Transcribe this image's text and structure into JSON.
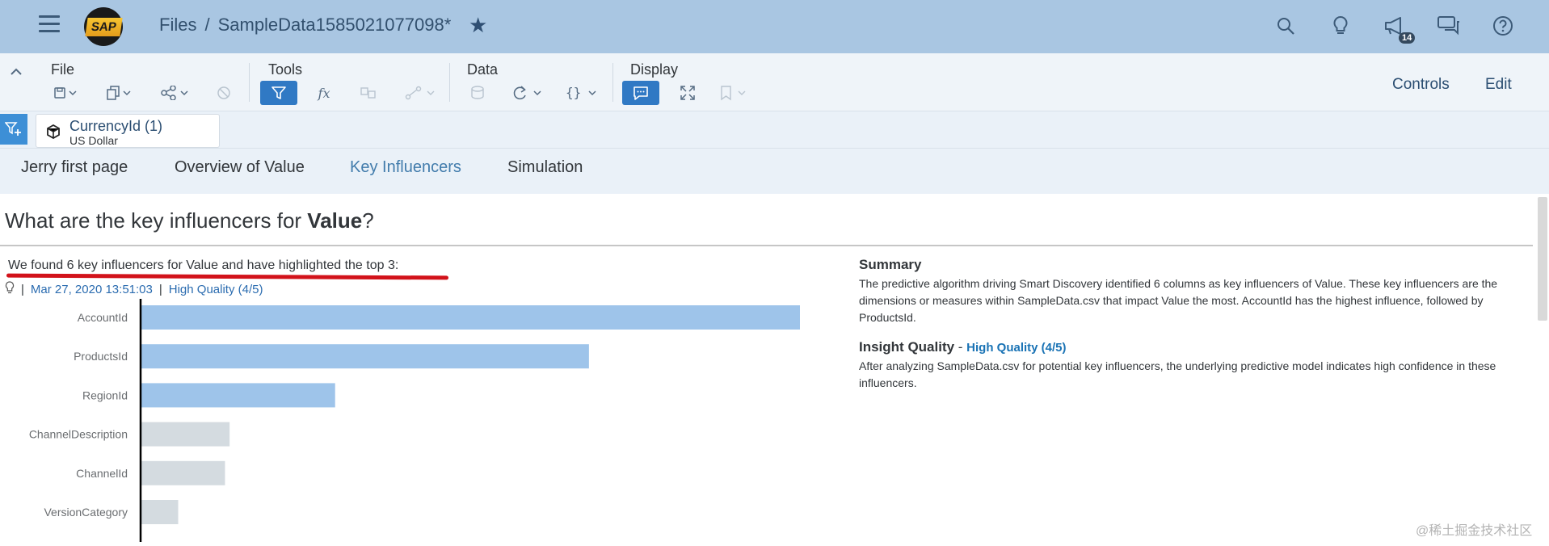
{
  "shell": {
    "breadcrumb_root": "Files",
    "breadcrumb_sep": "/",
    "document_title": "SampleData1585021077098*",
    "logo_text": "SAP",
    "notification_count": "14"
  },
  "toolbar": {
    "groups": {
      "file": "File",
      "tools": "Tools",
      "data": "Data",
      "display": "Display"
    },
    "controls_label": "Controls",
    "edit_label": "Edit"
  },
  "filter": {
    "token_title": "CurrencyId (1)",
    "token_value": "US Dollar"
  },
  "tabs": [
    {
      "label": "Jerry first page"
    },
    {
      "label": "Overview of Value"
    },
    {
      "label": "Key Influencers"
    },
    {
      "label": "Simulation"
    }
  ],
  "content": {
    "headline_prefix": "What are the key influencers for ",
    "headline_bold": "Value",
    "headline_suffix": "?",
    "found_text": "We found 6 key influencers for Value and have highlighted the top 3:",
    "timestamp": "Mar 27, 2020 13:51:03",
    "quality": "High Quality (4/5)"
  },
  "summary": {
    "title": "Summary",
    "text": "The predictive algorithm driving Smart Discovery identified 6 columns as key influencers of Value. These key influencers are the dimensions or measures within SampleData.csv that impact Value the most. AccountId has the highest influence, followed by ProductsId.",
    "insight_title": "Insight Quality",
    "insight_sep": " - ",
    "insight_quality": "High Quality (4/5)",
    "insight_text": "After analyzing SampleData.csv for potential key influencers, the underlying predictive model indicates high confidence in these influencers."
  },
  "chart_data": {
    "type": "bar",
    "orientation": "horizontal",
    "categories": [
      "AccountId",
      "ProductsId",
      "RegionId",
      "ChannelDescription",
      "ChannelId",
      "VersionCategory"
    ],
    "values": [
      100,
      68,
      29.5,
      13.5,
      12.8,
      5.7
    ],
    "highlighted": [
      true,
      true,
      true,
      false,
      false,
      false
    ],
    "colors": {
      "highlighted": "#9ec4ea",
      "other": "#d4dbe0"
    }
  },
  "watermark": "@稀土掘金技术社区"
}
